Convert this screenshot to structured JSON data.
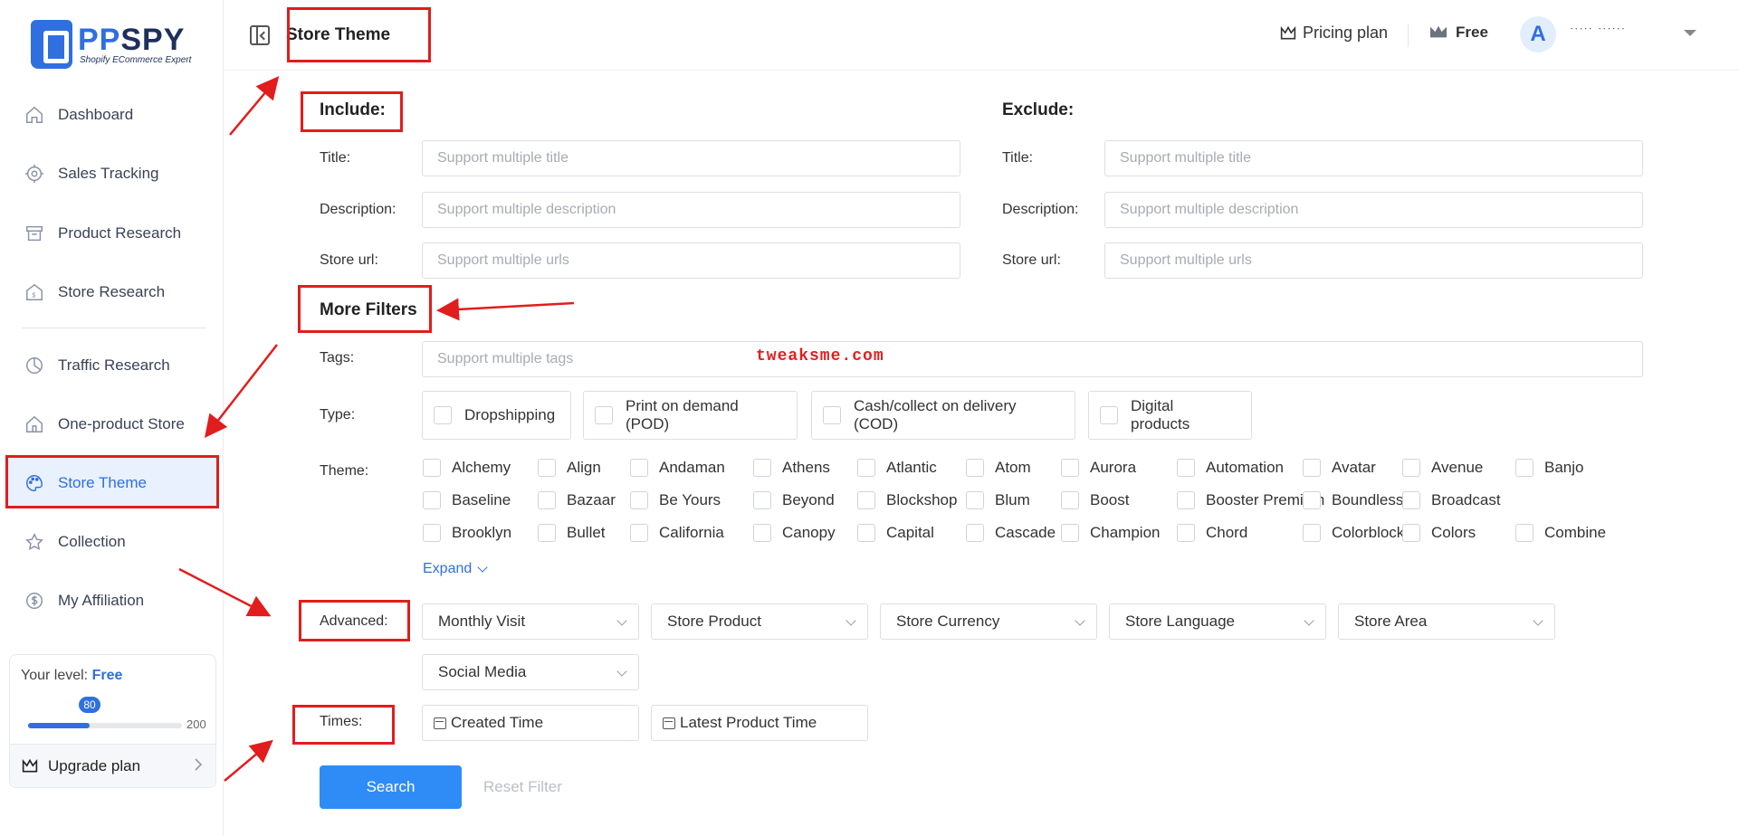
{
  "brand": {
    "name_prefix": "PP",
    "name_suffix": "SPY",
    "tagline": "Shopify ECommerce Expert"
  },
  "sidebar": {
    "items": [
      {
        "label": "Dashboard",
        "icon": "home-icon"
      },
      {
        "label": "Sales Tracking",
        "icon": "target-icon"
      },
      {
        "label": "Product Research",
        "icon": "archive-icon"
      },
      {
        "label": "Store Research",
        "icon": "store-icon"
      },
      {
        "label": "Traffic Research",
        "icon": "pie-chart-icon"
      },
      {
        "label": "One-product Store",
        "icon": "house-icon"
      },
      {
        "label": "Store Theme",
        "icon": "palette-icon",
        "active": true
      },
      {
        "label": "Collection",
        "icon": "star-icon"
      },
      {
        "label": "My Affiliation",
        "icon": "dollar-icon"
      }
    ],
    "level": {
      "label": "Your level:",
      "value": "Free",
      "current": "80",
      "max": "200",
      "progress": 0.4
    },
    "upgrade_label": "Upgrade plan"
  },
  "header": {
    "title": "Store Theme",
    "pricing_label": "Pricing plan",
    "plan_label": "Free",
    "avatar_letter": "A",
    "user_name": "ˑˑˑˑˑ ˑˑˑˑˑˑ"
  },
  "include": {
    "title": "Include:",
    "fields": [
      {
        "label": "Title:",
        "placeholder": "Support multiple title"
      },
      {
        "label": "Description:",
        "placeholder": "Support multiple description"
      },
      {
        "label": "Store url:",
        "placeholder": "Support multiple urls"
      }
    ]
  },
  "exclude": {
    "title": "Exclude:",
    "fields": [
      {
        "label": "Title:",
        "placeholder": "Support multiple title"
      },
      {
        "label": "Description:",
        "placeholder": "Support multiple description"
      },
      {
        "label": "Store url:",
        "placeholder": "Support multiple urls"
      }
    ]
  },
  "more_filters": {
    "title": "More Filters",
    "tags": {
      "label": "Tags:",
      "placeholder": "Support multiple tags"
    },
    "type": {
      "label": "Type:",
      "options": [
        "Dropshipping",
        "Print on demand (POD)",
        "Cash/collect on delivery (COD)",
        "Digital products"
      ]
    },
    "theme": {
      "label": "Theme:",
      "rows": [
        [
          "Alchemy",
          "Align",
          "Andaman",
          "Athens",
          "Atlantic",
          "Atom",
          "Aurora",
          "Automation",
          "Avatar",
          "Avenue",
          "Banjo"
        ],
        [
          "Baseline",
          "Bazaar",
          "Be Yours",
          "Beyond",
          "Blockshop",
          "Blum",
          "Boost",
          "Booster Premium",
          "Boundless",
          "Broadcast"
        ],
        [
          "Brooklyn",
          "Bullet",
          "California",
          "Canopy",
          "Capital",
          "Cascade",
          "Champion",
          "Chord",
          "Colorblock",
          "Colors",
          "Combine"
        ]
      ],
      "expand_label": "Expand"
    },
    "advanced": {
      "label": "Advanced:",
      "selects": [
        "Monthly Visit",
        "Store Product",
        "Store Currency",
        "Store Language",
        "Store Area",
        "Social Media"
      ]
    },
    "times": {
      "label": "Times:",
      "fields": [
        "Created Time",
        "Latest Product Time"
      ]
    }
  },
  "actions": {
    "search_label": "Search",
    "reset_label": "Reset Filter"
  },
  "watermark": "tweaksme.com",
  "colors": {
    "accent": "#2f6fe0",
    "annotation": "#e11d1d",
    "button": "#2f8cf7"
  }
}
